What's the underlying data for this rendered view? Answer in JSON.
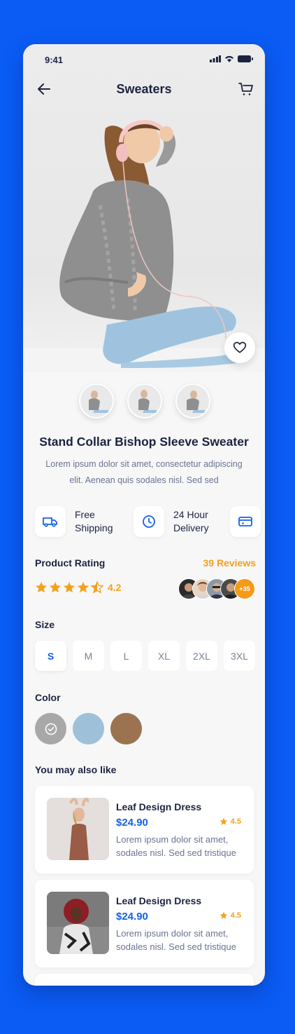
{
  "status": {
    "time": "9:41"
  },
  "nav": {
    "title": "Sweaters"
  },
  "product": {
    "name": "Stand Collar Bishop Sleeve Sweater",
    "description": "Lorem ipsum dolor sit amet, consectetur adipiscing elit. Aenean quis sodales nisl. Sed sed"
  },
  "features": [
    {
      "icon": "truck-icon",
      "line1": "Free",
      "line2": "Shipping"
    },
    {
      "icon": "clock-icon",
      "line1": "24 Hour",
      "line2": "Delivery"
    },
    {
      "icon": "card-icon"
    }
  ],
  "rating": {
    "label": "Product Rating",
    "reviews": "39 Reviews",
    "value": "4.2",
    "stars": 4.5,
    "more_reviewers": "+35"
  },
  "size": {
    "label": "Size",
    "options": [
      "S",
      "M",
      "L",
      "XL",
      "2XL",
      "3XL"
    ],
    "selected": "S"
  },
  "color": {
    "label": "Color",
    "options": [
      "#a8a8a8",
      "#9ec0d8",
      "#9c7350"
    ],
    "selected_index": 0
  },
  "recommend": {
    "label": "You may also like",
    "items": [
      {
        "name": "Leaf Design Dress",
        "price": "$24.90",
        "rating": "4.5",
        "description": "Lorem ipsum dolor sit amet, sodales nisl. Sed sed tristique"
      },
      {
        "name": "Leaf Design Dress",
        "price": "$24.90",
        "rating": "4.5",
        "description": "Lorem ipsum dolor sit amet, sodales nisl. Sed sed tristique"
      }
    ]
  },
  "colors": {
    "accent": "#1262ea",
    "rating": "#f5a01a",
    "background": "#0a5cf5"
  }
}
